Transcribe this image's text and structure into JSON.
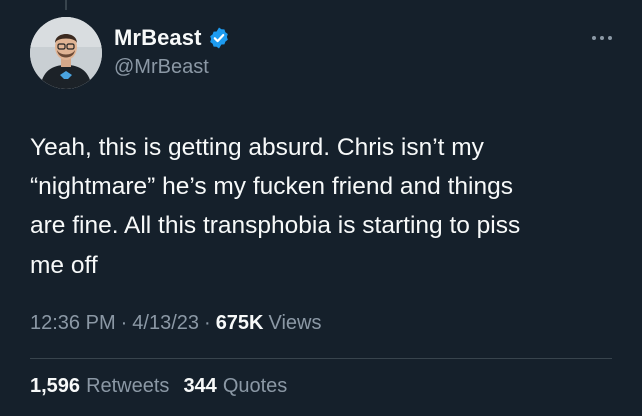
{
  "author": {
    "display_name": "MrBeast",
    "handle": "@MrBeast",
    "verified": true,
    "verified_color": "#1d9bf0"
  },
  "tweet": {
    "text": "Yeah, this is getting absurd. Chris isn’t my\n“nightmare” he’s my fucken friend and things\nare fine. All this transphobia is starting to piss\nme off",
    "time": "12:36 PM",
    "date": "4/13/23",
    "separator": "·",
    "views_count": "675K",
    "views_label": "Views"
  },
  "stats": {
    "retweets_count": "1,596",
    "retweets_label": "Retweets",
    "quotes_count": "344",
    "quotes_label": "Quotes"
  },
  "icons": {
    "more": "more-horizontal-icon",
    "verified": "verified-badge-icon"
  },
  "colors": {
    "background": "#15202b",
    "text_primary": "#f7f9f9",
    "text_secondary": "#8b98a5",
    "divider": "#38444d"
  }
}
